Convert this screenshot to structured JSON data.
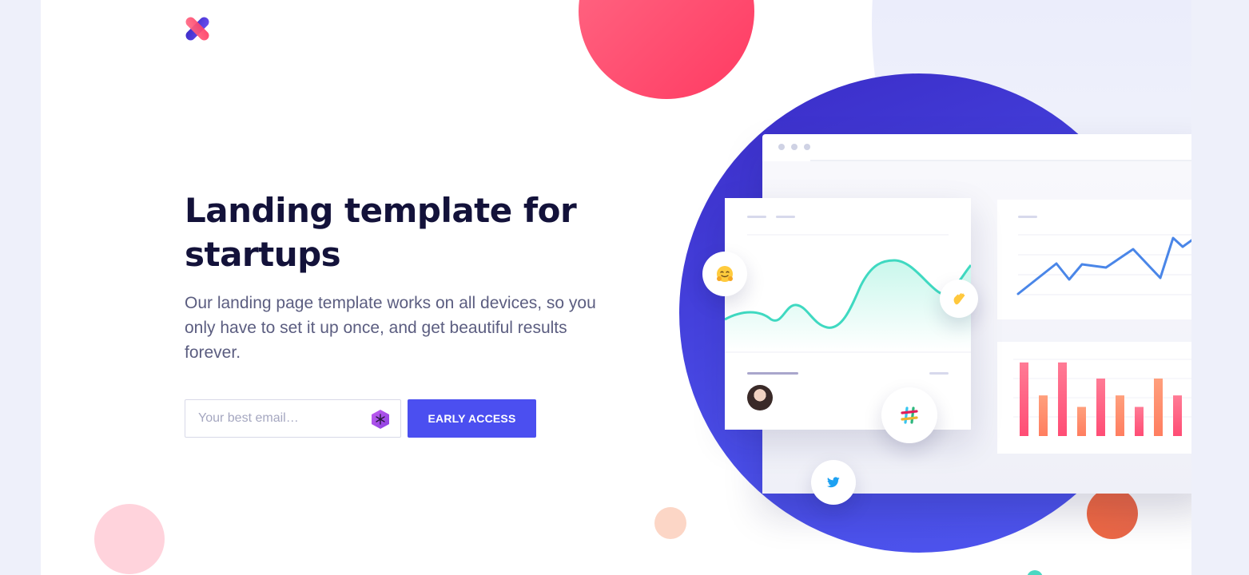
{
  "hero": {
    "title": "Landing template for startups",
    "subtitle": "Our landing page template works on all devices, so you only have to set it up once, and get beautiful results forever."
  },
  "signup": {
    "email_placeholder": "Your best email…",
    "button_label": "EARLY ACCESS"
  },
  "illustration": {
    "icons": [
      "hug-emoji-icon",
      "wave-emoji-icon",
      "slack-icon",
      "twitter-icon"
    ],
    "bar_chart": {
      "type": "bar",
      "values": [
        96,
        53,
        96,
        38,
        75,
        53,
        38,
        75,
        53
      ]
    },
    "colors": {
      "accent": "#4b4ff0",
      "circle": "#3a2bc6",
      "teal": "#3fd9c1",
      "pink": "#ff3a62"
    }
  }
}
